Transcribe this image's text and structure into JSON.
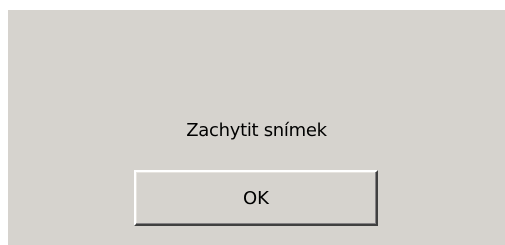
{
  "dialog": {
    "message": "Zachytit snímek",
    "ok_label": "OK"
  },
  "colors": {
    "face": "#d6d3ce",
    "highlight": "#ffffff",
    "shadow": "#404040",
    "text": "#000000"
  }
}
